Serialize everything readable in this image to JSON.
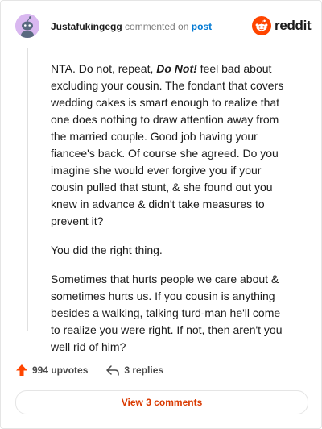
{
  "header": {
    "username": "Justafukingegg",
    "commented_on": "commented on",
    "post_link": "post",
    "brand": "reddit"
  },
  "comment": {
    "p1_before": "NTA. Do not, repeat, ",
    "p1_emph": "Do Not!",
    "p1_after": " feel bad about excluding your cousin. The fondant that covers wedding cakes is smart enough to realize that one does nothing to draw attention away from the married couple. Good job having your fiancee's back. Of course she agreed. Do you imagine she would ever forgive you if your cousin pulled that stunt, & she found out you knew in advance & didn't take measures to prevent it?",
    "p2": "You did the right thing.",
    "p3": "Sometimes that hurts people we care about & sometimes hurts us. If you cousin is anything besides a walking, talking turd-man he'll come to realize you were right. If not, then aren't you well rid of him?"
  },
  "actions": {
    "upvotes": "994 upvotes",
    "replies": "3 replies"
  },
  "footer": {
    "view_comments": "View 3 comments"
  },
  "colors": {
    "brand": "#ff4500",
    "link": "#0079d3",
    "view_comments": "#d93900",
    "avatar_bg": "#d9b8f0"
  }
}
